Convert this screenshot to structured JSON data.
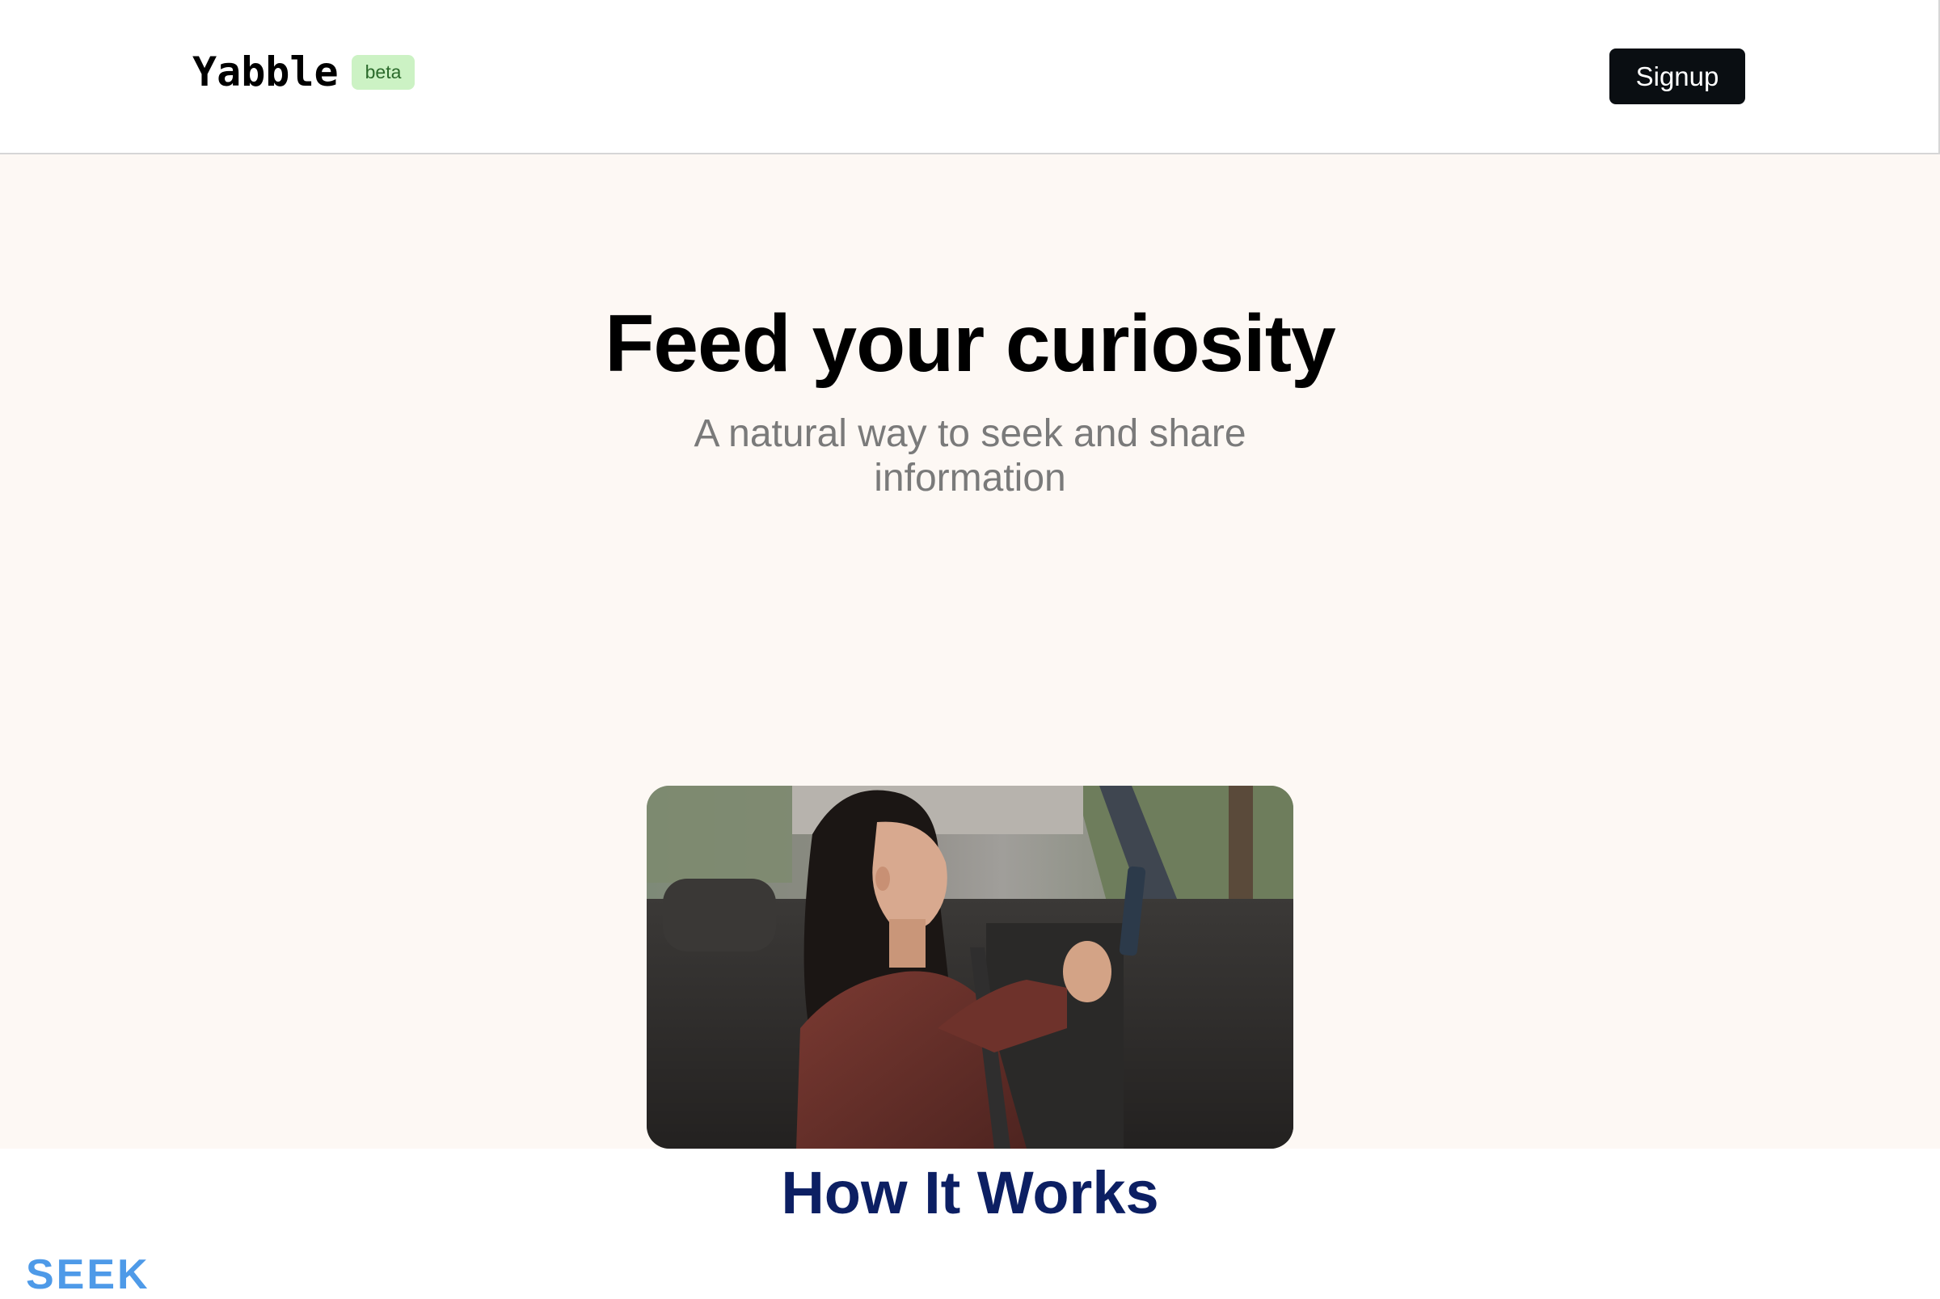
{
  "header": {
    "logo": "Yabble",
    "badge": "beta",
    "signup_label": "Signup"
  },
  "hero": {
    "title": "Feed your curiosity",
    "subtitle": "A natural way to seek and share information",
    "video_alt": "Woman in a car back seat smiling at her phone"
  },
  "how": {
    "title": "How It Works",
    "first_step": "SEEK"
  },
  "colors": {
    "hero_bg": "#fdf8f4",
    "badge_bg": "#ccf2c4",
    "badge_text": "#2b6a2b",
    "button_bg": "#0a0e12",
    "how_title": "#0c1f63",
    "seek_label": "#4e9ae8"
  }
}
